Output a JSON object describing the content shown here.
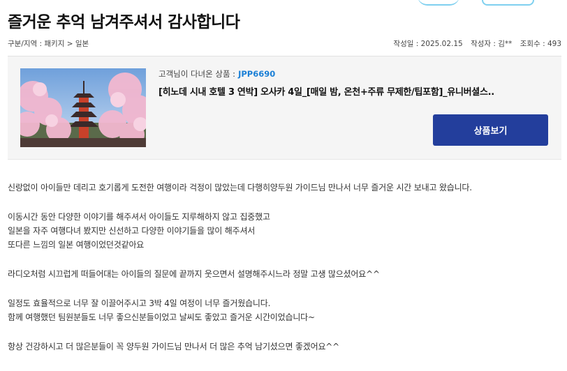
{
  "title": "즐거운 추억 남겨주셔서 감사합니다",
  "meta": {
    "category": "구분/지역 : 패키지 > 일본",
    "date": "작성일 : 2025.02.15",
    "author": "작성자 : 김**",
    "views": "조회수 : 493"
  },
  "product": {
    "subtitle_label": "고객님이 다녀온 상품 :",
    "code": "JPP6690",
    "name": "[히노데 시내 호텔 3 연박] 오사카 4일_[매일 밤, 온천+주류 무제한/팁포함]_유니버셜스..",
    "button_label": "상품보기",
    "image_alt": "pagoda-cherry-blossom-photo"
  },
  "body_lines": [
    "신랑없이 아이들만 데리고 호기롭게 도전한 여행이라 걱정이 많았는데 다행히양두원 가이드님 만나서 너무 즐거운 시간 보내고 왔습니다.",
    "",
    "이동시간 동안 다양한 이야기를 해주셔서 아이들도 지루해하지 않고 집중했고",
    "일본을 자주 여행다녀 봤지만 신선하고 다양한 이야기들을 많이 해주셔서",
    "또다른 느낌의 일본 여행이었던것같아요",
    "",
    "라디오처럼 시끄럽게 떠들어대는 아이들의 질문에 끝까지 웃으면서 설명해주시느라 정말 고생 많으셨어요^^",
    "",
    "일정도 효율적으로 너무 잘 이끌어주시고 3박 4일 여정이 너무 즐거웠습니다.",
    "함께 여행했던 팀원분들도 너무 좋으신분들이었고 날씨도 좋았고 즐거운 시간이었습니다~",
    "",
    "항상 건강하시고 더 많은분들이 꼭 양두원 가이드님 만나서 더 많은 추억 남기셨으면 좋겠어요^^"
  ],
  "colors": {
    "accent": "#1a7fd6",
    "button": "#233e9c"
  }
}
